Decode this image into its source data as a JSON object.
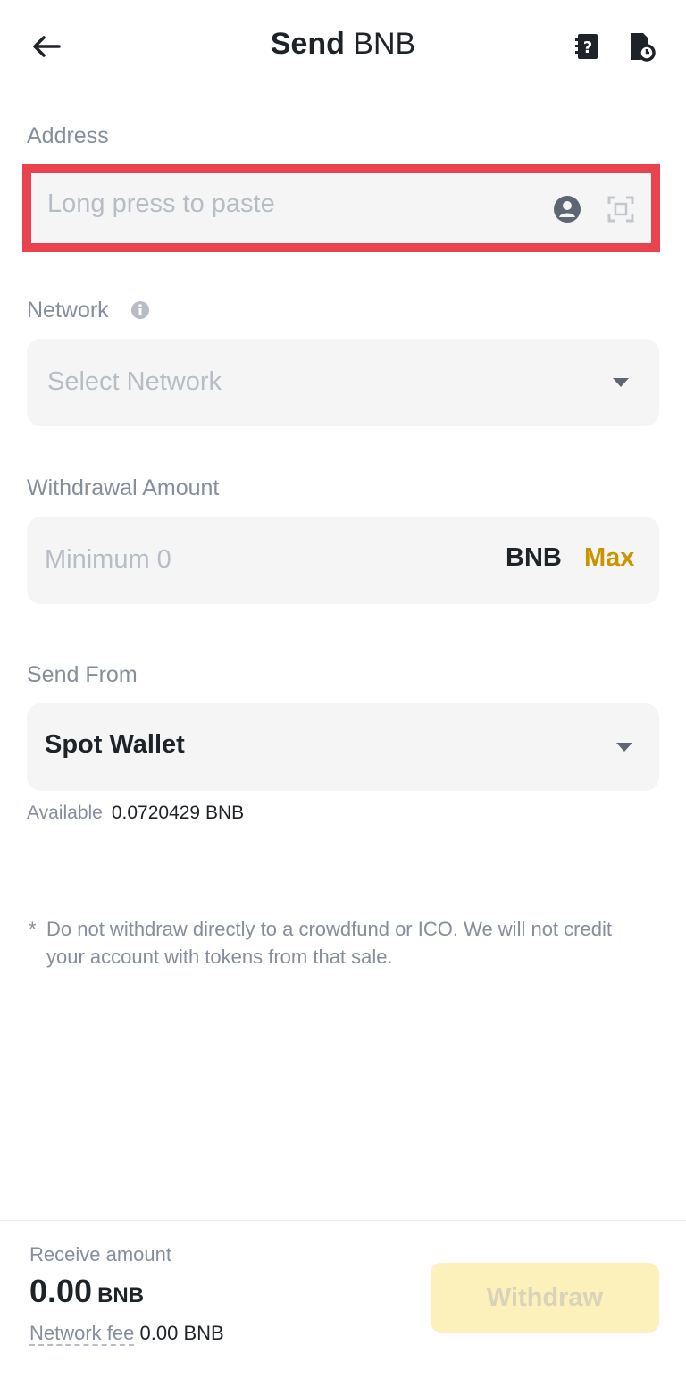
{
  "header": {
    "title_bold": "Send",
    "title_asset": "BNB"
  },
  "address": {
    "label": "Address",
    "placeholder": "Long press to paste"
  },
  "network": {
    "label": "Network",
    "placeholder": "Select Network"
  },
  "amount": {
    "label": "Withdrawal Amount",
    "placeholder": "Minimum 0",
    "unit": "BNB",
    "max_label": "Max"
  },
  "send_from": {
    "label": "Send From",
    "value": "Spot Wallet",
    "available_label": "Available",
    "available_value": "0.0720429 BNB"
  },
  "notice": {
    "star": "*",
    "text": "Do not withdraw directly to a crowdfund or ICO. We will not credit your account with tokens from that sale."
  },
  "footer": {
    "receive_label": "Receive amount",
    "receive_value": "0.00",
    "receive_unit": "BNB",
    "fee_label": "Network fee",
    "fee_value": "0.00 BNB",
    "withdraw_label": "Withdraw"
  },
  "colors": {
    "accent": "#c99400",
    "highlight": "#e8434e",
    "withdraw_disabled_bg": "#fcf0bb"
  },
  "icons": [
    "back-arrow-icon",
    "faq-book-icon",
    "history-icon",
    "contact-icon",
    "scan-icon",
    "info-icon",
    "chevron-down-icon"
  ]
}
